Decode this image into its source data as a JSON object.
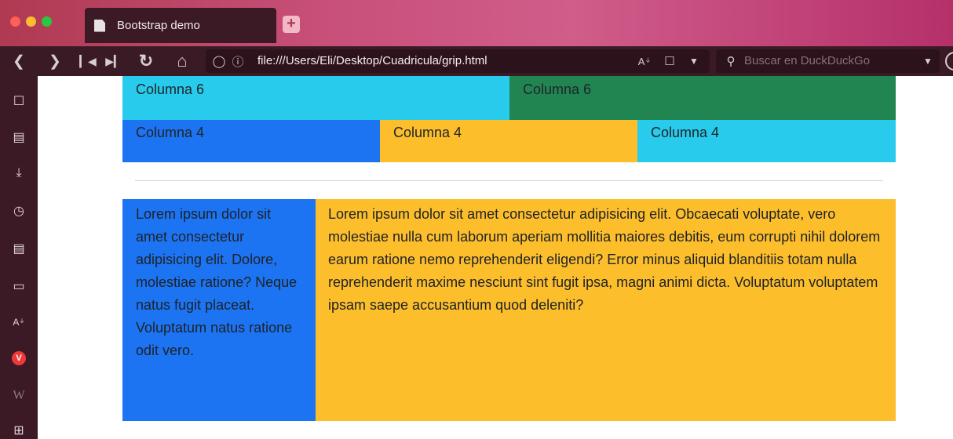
{
  "tab": {
    "title": "Bootstrap demo",
    "new_tab": "+"
  },
  "toolbar": {
    "url": "file:///Users/Eli/Desktop/Cuadricula/grip.html",
    "search_placeholder": "Buscar en DuckDuckGo"
  },
  "page": {
    "row1": [
      "Columna 6",
      "Columna 6"
    ],
    "row2": [
      "Columna 4",
      "Columna 4",
      "Columna 4"
    ],
    "side_text": "Lorem ipsum dolor sit amet consectetur adipisicing elit. Dolore, molestiae ratione? Neque natus fugit placeat. Voluptatum natus ratione odit vero.",
    "main_text": "Lorem ipsum dolor sit amet consectetur adipisicing elit. Obcaecati voluptate, vero molestiae nulla cum laborum aperiam mollitia maiores debitis, eum corrupti nihil dolorem earum ratione nemo reprehenderit eligendi? Error minus aliquid blanditiis totam nulla reprehenderit maxime nesciunt sint fugit ipsa, magni animi dicta. Voluptatum voluptatem ipsam saepe accusantium quod deleniti?"
  },
  "colors": {
    "primary": "#1d74f2",
    "info": "#28cbec",
    "success": "#218552",
    "warning": "#fdbe2c"
  },
  "icons": {
    "sidebar": [
      "bookmark-icon",
      "reader-icon",
      "downloads-icon",
      "history-icon",
      "notes-icon",
      "window-icon",
      "translate-icon",
      "vivaldi-icon",
      "wikipedia-icon",
      "add-panel-icon"
    ]
  }
}
